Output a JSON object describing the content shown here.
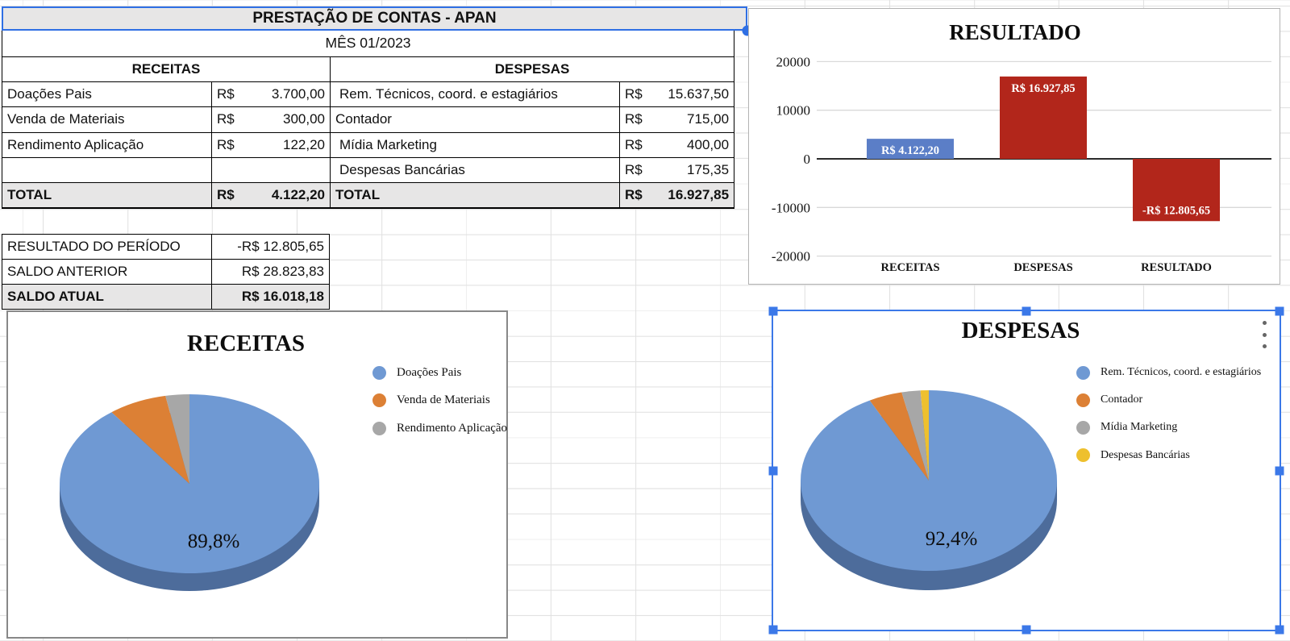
{
  "sheet": {
    "title": "PRESTAÇÃO DE CONTAS - APAN",
    "month": "MÊS 01/2023",
    "receitas": {
      "header": "RECEITAS",
      "rows": [
        {
          "label": "Doações Pais",
          "cur": "R$",
          "val": "3.700,00"
        },
        {
          "label": "Venda de Materiais",
          "cur": "R$",
          "val": "300,00"
        },
        {
          "label": "Rendimento Aplicação",
          "cur": "R$",
          "val": "122,20"
        },
        {
          "label": "",
          "cur": "",
          "val": ""
        }
      ]
    },
    "despesas": {
      "header": "DESPESAS",
      "rows": [
        {
          "label": "Rem. Técnicos, coord. e estagiários",
          "cur": "R$",
          "val": "15.637,50"
        },
        {
          "label": "Contador",
          "cur": "R$",
          "val": "715,00"
        },
        {
          "label": "Mídia Marketing",
          "cur": "R$",
          "val": "400,00"
        },
        {
          "label": "Despesas Bancárias",
          "cur": "R$",
          "val": "175,35"
        }
      ]
    },
    "total_row": {
      "label1": "TOTAL",
      "cur1": "R$",
      "val1": "4.122,20",
      "label2": "TOTAL",
      "cur2": "R$",
      "val2": "16.927,85"
    },
    "summary": {
      "rows": [
        {
          "label": "RESULTADO DO PERÍODO",
          "value": "-R$ 12.805,65"
        },
        {
          "label": "SALDO ANTERIOR",
          "value": "R$ 28.823,83"
        },
        {
          "label": "SALDO ATUAL",
          "value": "R$ 16.018,18"
        }
      ]
    }
  },
  "colors": {
    "selection_blue": "#3b78e8",
    "bar_blue": "#5b7ec7",
    "bar_red": "#b2261b",
    "pie_blue": "#6f99d3",
    "pie_blue_side": "#4d6c9b",
    "pie_orange": "#dc8035",
    "pie_gray": "#a7a7a7",
    "pie_yellow": "#eec02e",
    "table_fill": "#e7e6e6"
  },
  "chart_data": [
    {
      "id": "resultado_bar",
      "type": "bar",
      "title": "RESULTADO",
      "categories": [
        "RECEITAS",
        "DESPESAS",
        "RESULTADO"
      ],
      "values": [
        4122.2,
        16927.85,
        -12805.65
      ],
      "value_labels": [
        "R$  4.122,20",
        "R$  16.927,85",
        "-R$  12.805,65"
      ],
      "colors": [
        "#5b7ec7",
        "#b2261b",
        "#b2261b"
      ],
      "ylim": [
        -20000,
        20000
      ],
      "yticks": [
        20000,
        10000,
        0,
        -10000,
        -20000
      ],
      "ytick_labels": [
        "20000",
        "10000",
        "0",
        "-10000",
        "-20000"
      ],
      "grid": true,
      "legend_position": "none"
    },
    {
      "id": "receitas_pie",
      "type": "pie",
      "title": "RECEITAS",
      "labels": [
        "Doações Pais",
        "Venda de Materiais",
        "Rendimento Aplicação"
      ],
      "values": [
        3700.0,
        300.0,
        122.2
      ],
      "percents": [
        89.8,
        7.3,
        3.0
      ],
      "percent_label": "89,8%",
      "colors": [
        "#6f99d3",
        "#dc8035",
        "#a7a7a7"
      ],
      "side_color": "#4d6c9b",
      "legend_position": "right"
    },
    {
      "id": "despesas_pie",
      "type": "pie",
      "title": "DESPESAS",
      "labels": [
        "Rem. Técnicos, coord. e estagiários",
        "Contador",
        "Mídia Marketing",
        "Despesas Bancárias"
      ],
      "values": [
        15637.5,
        715.0,
        400.0,
        175.35
      ],
      "percents": [
        92.4,
        4.2,
        2.4,
        1.0
      ],
      "percent_label": "92,4%",
      "colors": [
        "#6f99d3",
        "#dc8035",
        "#a7a7a7",
        "#eec02e"
      ],
      "side_color": "#4d6c9b",
      "legend_position": "right",
      "selected": true
    }
  ]
}
